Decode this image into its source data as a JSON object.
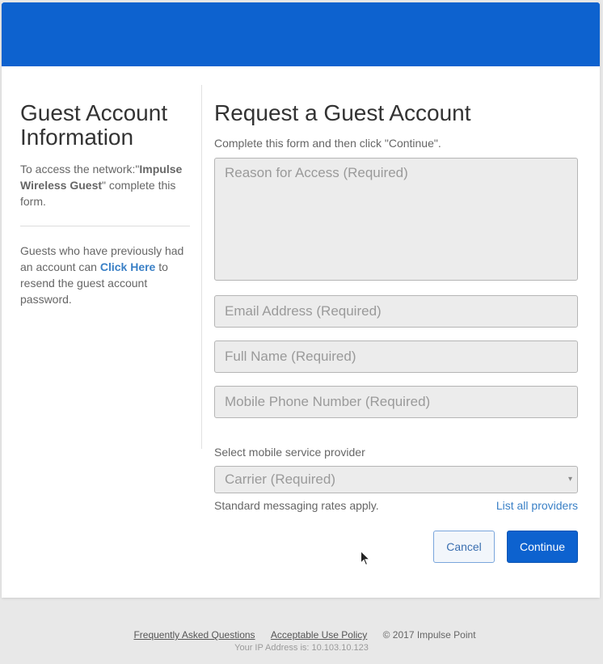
{
  "sidebar": {
    "title": "Guest Account Information",
    "intro_prefix": "To access the network:\"",
    "network_name": "Impulse Wireless Guest",
    "intro_suffix": "\" complete this form.",
    "resend_prefix": "Guests who have previously had an account can ",
    "resend_link": "Click Here",
    "resend_suffix": " to resend the guest account password."
  },
  "form": {
    "title": "Request a Guest Account",
    "instructions": "Complete this form and then click \"Continue\".",
    "reason_placeholder": "Reason for Access (Required)",
    "email_placeholder": "Email Address (Required)",
    "name_placeholder": "Full Name (Required)",
    "phone_placeholder": "Mobile Phone Number (Required)",
    "provider_label": "Select mobile service provider",
    "carrier_selected": "Carrier (Required)",
    "rates_note": "Standard messaging rates apply.",
    "list_providers": "List all providers",
    "cancel_label": "Cancel",
    "continue_label": "Continue"
  },
  "footer": {
    "faq": "Frequently Asked Questions",
    "aup": "Acceptable Use Policy",
    "copyright": "© 2017 Impulse Point",
    "ip_text": "Your IP Address is: 10.103.10.123"
  },
  "colors": {
    "brand_blue": "#0d62cf",
    "link_blue": "#3a80c6"
  },
  "icons": {
    "select_caret": "▾",
    "cursor": "mouse-pointer-icon"
  }
}
